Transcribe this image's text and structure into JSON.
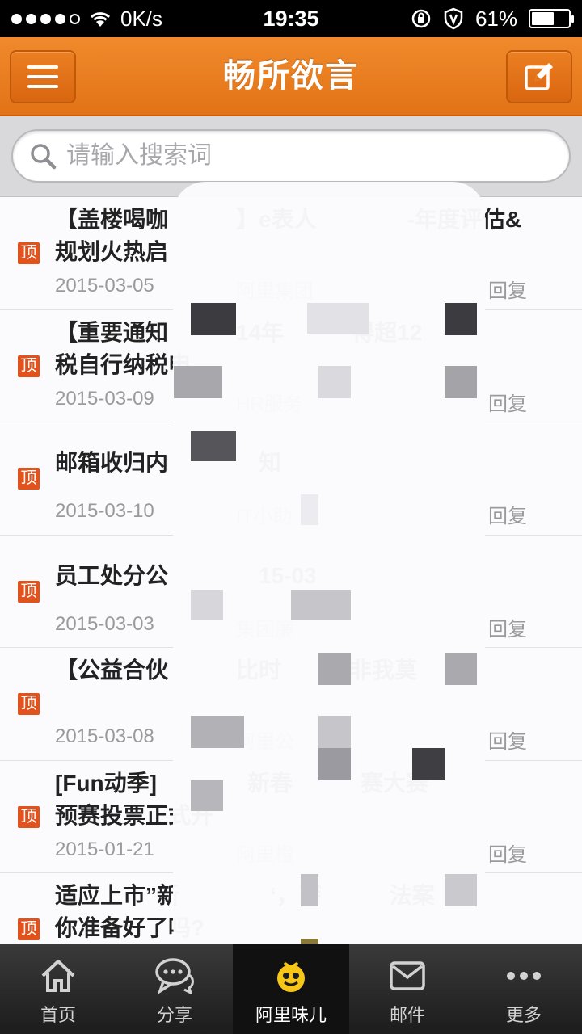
{
  "status_bar": {
    "carrier_dots": 5,
    "network_speed": "0K/s",
    "time": "19:35",
    "battery_percent": "61%",
    "battery_level": 0.61,
    "icons": [
      "wifi-icon",
      "orientation-lock-icon",
      "vpn-shield-icon",
      "battery-icon"
    ]
  },
  "nav": {
    "title": "畅所欲言",
    "left_icon": "menu-icon",
    "right_icon": "compose-icon"
  },
  "search": {
    "placeholder": "请输入搜索词",
    "value": ""
  },
  "badge_label": "顶",
  "posts": [
    {
      "title": "【盖楼喝咖　　　】e表人　　　　-年度评估&规划火热启",
      "date": "2015-03-05",
      "author": "阿里集团",
      "reply": "回复",
      "pinned": true
    },
    {
      "title": "【重要通知　　　14年　　　得超12　　　　税自行纳税申",
      "date": "2015-03-09",
      "author": "HR服务",
      "reply": "回复",
      "pinned": true
    },
    {
      "title": "邮箱收归内　　　　知",
      "date": "2015-03-10",
      "author": "IT小助",
      "reply": "回复",
      "pinned": true
    },
    {
      "title": "员工处分公　　　　15-03",
      "date": "2015-03-03",
      "author": "集团廉",
      "reply": "回复",
      "pinned": true
    },
    {
      "title": "【公益合伙　　　比时　　　非我莫",
      "date": "2015-03-08",
      "author": "阿里公",
      "reply": "回复",
      "pinned": true
    },
    {
      "title": "[Fun动季]　　　　新春　　　赛大赛　　　　预赛投票正式开",
      "date": "2015-01-21",
      "author": "阿里橙",
      "reply": "回复",
      "pinned": true
    },
    {
      "title": "适应上市”新　　　　‘，萨　　　法案　　　　　你准备好了吗?",
      "date": "",
      "author": "",
      "reply": "",
      "pinned": true
    }
  ],
  "tabs": [
    {
      "label": "首页",
      "icon": "home-icon",
      "active": false
    },
    {
      "label": "分享",
      "icon": "chat-bubble-icon",
      "active": false
    },
    {
      "label": "阿里味儿",
      "icon": "ali-flavor-icon",
      "active": true
    },
    {
      "label": "邮件",
      "icon": "mail-icon",
      "active": false
    },
    {
      "label": "更多",
      "icon": "more-icon",
      "active": false
    }
  ],
  "colors": {
    "accent": "#e27316",
    "badge": "#e2521c",
    "active_icon": "#f5c518"
  }
}
